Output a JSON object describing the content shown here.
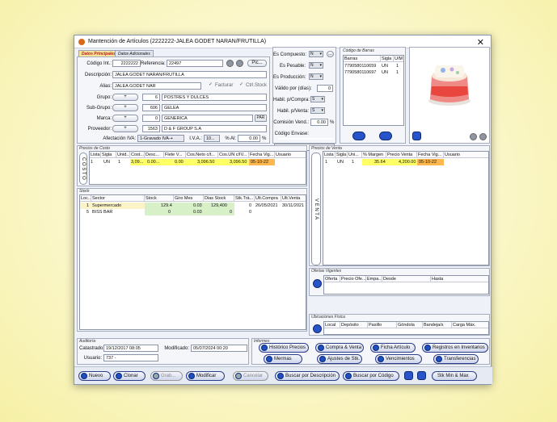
{
  "window": {
    "title": "Mantención de Artículos  (2222222-JALEA GODET NARAN/FRUTILLA)",
    "close": "✕"
  },
  "tabs": [
    "Datos Principales",
    "Datos Adicionales"
  ],
  "main": {
    "codigo_label": "Código Int.:",
    "codigo": "2222222",
    "referencia_label": "Referencia:",
    "referencia": "22497",
    "pic_btn": "Pic...",
    "descripcion_label": "Descripción:",
    "descripcion": "JALEA GODET NARAN/FRUTILLA",
    "alias_label": "Alias:",
    "alias": "JALEA GODET NAR",
    "facturar": "Facturar",
    "ctrl_stock": "Ctrl.Stock",
    "grupo_label": "Grupo:",
    "grupo_num": "6",
    "grupo": "POSTRES Y DULCES",
    "subgrupo_label": "Sub-Grupo:",
    "subgrupo_num": "606",
    "subgrupo": "GELEA",
    "marca_label": "Marca:",
    "marca_num": "0",
    "marca": "GENERICA",
    "par_btn": "PAR",
    "proveedor_label": "Proveedor:",
    "proveedor_num": "1563",
    "proveedor": "D & F GROUP S.A",
    "afectacion_label": "Afectación IVA:",
    "afectacion": "1-Gravado IVA-+",
    "iva_label": "I.V.A.:",
    "iva": "10...",
    "al_label": "% Al:",
    "al": "0.00",
    "pct": "%",
    "plus": "+"
  },
  "flags": {
    "compuesto_label": "Es Compuesto:",
    "compuesto": "N",
    "pesable_label": "Es Pesable:",
    "pesable": "N",
    "produccion_label": "Es Producción:",
    "produccion": "N",
    "valido_label": "Válido por (días):",
    "valido": "0",
    "habil_compra_label": "Habil. p/Compra:",
    "habil_compra": "S",
    "habil_venta_label": "Habil. p/Venta:",
    "habil_venta": "S",
    "comision_label": "Comisión Vend.:",
    "comision": "0.00",
    "comision_pct": "%",
    "envase_label": "Código Envase:",
    "envase": "",
    "more": "..."
  },
  "barras": {
    "title": "Código de Barras",
    "cols": [
      "Barras",
      "Sigla",
      "U/M"
    ],
    "rows": [
      [
        "7790580110659",
        "UN",
        "1"
      ],
      [
        "7790580110697",
        "UN",
        "1"
      ]
    ]
  },
  "costo": {
    "title": "Precios de Costo",
    "side": "C O S T O",
    "cols": [
      "Lista",
      "Sigla",
      "Unid...",
      "Cost...",
      "Desc...",
      "Flete V...",
      "Cos.Neto c/t...",
      "Cos.UN c/IV...",
      "Fecha Vig...",
      "Usuario"
    ],
    "row": [
      "1",
      "UN",
      "1",
      "3,09...",
      "0.00...",
      "0.00",
      "3,096.50",
      "3,096.50",
      "05-10-22",
      ""
    ]
  },
  "venta": {
    "title": "Precios de Venta",
    "side": "V E N T A",
    "cols": [
      "Lista",
      "Sigla",
      "Uni...",
      "% Margen",
      "Precio Venta",
      "Fecha Vig...",
      "Usuario"
    ],
    "row": [
      "1",
      "UN",
      "1",
      "35.64",
      "4,200.00",
      "05-10-22",
      ""
    ]
  },
  "stock": {
    "title": "Stock",
    "cols": [
      "Loc...",
      "Sector",
      "Stock",
      "Giro Mes",
      "Dias Stock",
      "Stk.Trá...",
      "Ult.Compra",
      "Ult.Venta"
    ],
    "rows": [
      [
        "1",
        "Supermercado",
        "129.4",
        "0.03",
        "129,400",
        "0",
        "26/05/2021",
        "30/11/2021"
      ],
      [
        "5",
        "BISS BAR",
        "0",
        "0.03",
        "0",
        "0",
        "",
        ""
      ]
    ]
  },
  "ofertas": {
    "title": "Ofertas Vigentes",
    "cols": [
      "Oferta",
      "Precio Ofe...",
      "Empa...",
      "Desde",
      "Hasta"
    ]
  },
  "ubicaciones": {
    "title": "Ubicaciones Física",
    "cols": [
      "Local",
      "Depósito",
      "Pasillo",
      "Góndola",
      "Bandeja/s",
      "Carga Máx."
    ]
  },
  "auditoria": {
    "title": "Auditoría",
    "catastrado_label": "Catastrado:",
    "catastrado": "19/12/2017 08:05",
    "modificado_label": "Modificado:",
    "modificado": "05/07/2024 00:20",
    "usuario_label": "Usuario:",
    "usuario": "737 -"
  },
  "informes": {
    "title": "Informes",
    "buttons": [
      "Histórico Precios",
      "Compra & Venta",
      "Ficha Artículo",
      "Registros en Inventarios",
      "Mermas",
      "Ajustes de Stk.",
      "Vencimientos",
      "Transferencias"
    ]
  },
  "footer": {
    "nuevo": "Nuevo",
    "clonar": "Clonar",
    "grabar": "Grab...",
    "modificar": "Modificar",
    "cancelar": "Cancelar",
    "buscar_desc": "Buscar por Descripción",
    "buscar_cod": "Buscar por Código",
    "stk": "Stk Min & Max"
  },
  "colors": {
    "highlight": "#ffff66",
    "orange": "#ffb84d",
    "green": "#d8f0c8",
    "accent": "#1e4fc0"
  }
}
